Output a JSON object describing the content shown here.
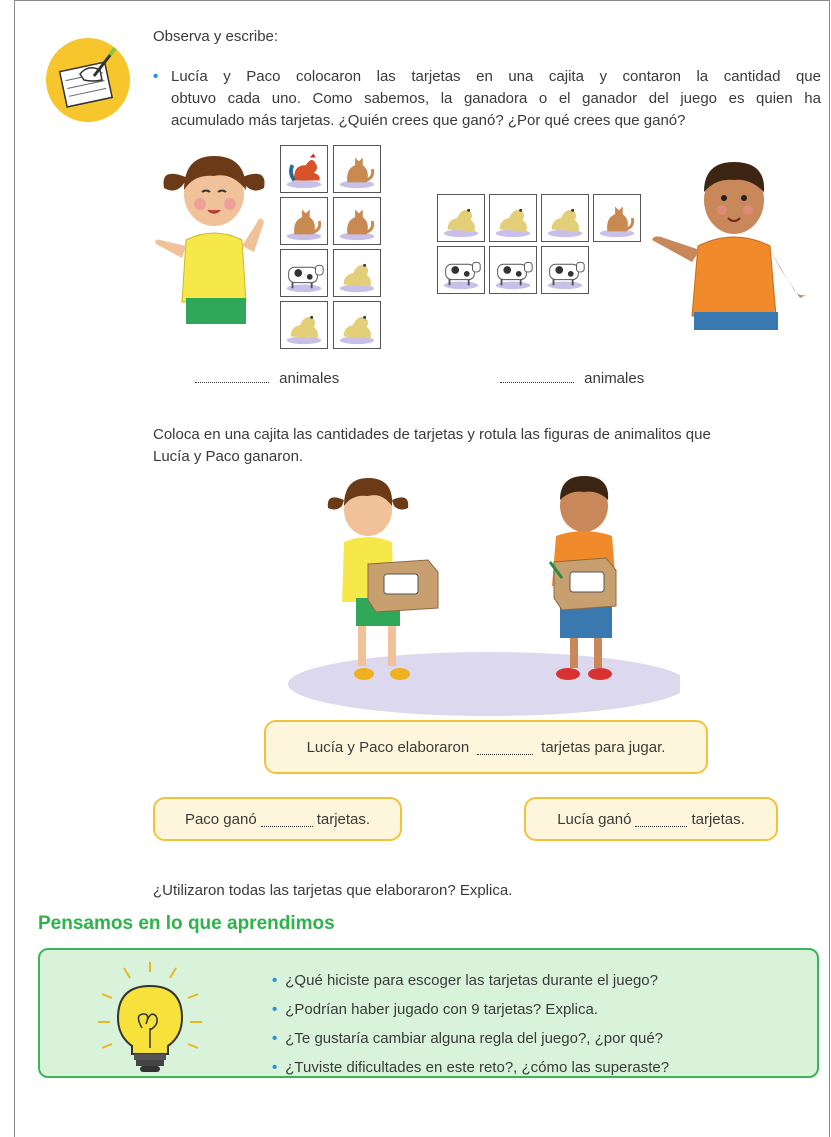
{
  "intro": {
    "observa": "Observa y escribe:"
  },
  "paragraph1": "Lucía y Paco colocaron las tarjetas en una cajita y contaron la cantidad que obtuvo cada uno. Como sabemos, la ganadora o el ganador del juego es quien ha acumulado más tarjetas. ¿Quién crees que ganó? ¿Por qué crees que ganó?",
  "paragraph1_lines": [
    "Lucía y Paco colocaron las tarjetas en una cajita y contaron la cantidad que",
    "obtuvo cada uno. Como sabemos, la ganadora o el ganador del juego es quien ha",
    "acumulado más tarjetas. ¿Quién crees que ganó? ¿Por qué crees que ganó?"
  ],
  "animals_label": "animales",
  "instruction2_lines": [
    "Coloca en una cajita las cantidades de tarjetas y rotula las figuras de animalitos que",
    "Lucía y Paco ganaron."
  ],
  "box_total": {
    "before": "Lucía y Paco elaboraron",
    "after": "tarjetas para jugar."
  },
  "box_paco": {
    "before": "Paco ganó",
    "after": "tarjetas."
  },
  "box_lucia": {
    "before": "Lucía ganó",
    "after": "tarjetas."
  },
  "question_utilizaron": "¿Utilizaron todas las tarjetas que elaboraron? Explica.",
  "section_title": "Pensamos en lo que aprendimos",
  "reflection_items": [
    "¿Qué hiciste para escoger las tarjetas durante el juego?",
    "¿Podrían haber jugado con 9 tarjetas? Explica.",
    "¿Te gustaría cambiar alguna regla del juego?, ¿por qué?",
    "¿Tuviste dificultades en este reto?, ¿cómo las superaste?"
  ],
  "lucia_cards": [
    "gallo",
    "gato",
    "gato",
    "gato",
    "vaca",
    "perro",
    "perro",
    "perro"
  ],
  "paco_cards_row1": [
    "perro",
    "perro",
    "perro",
    "gato"
  ],
  "paco_cards_row2": [
    "vaca",
    "vaca",
    "vaca"
  ],
  "colors": {
    "accent_blue": "#2f8fd6",
    "title_green": "#2db34a",
    "box_yellow": "#f1c33c",
    "box_green": "#3cb55a"
  }
}
